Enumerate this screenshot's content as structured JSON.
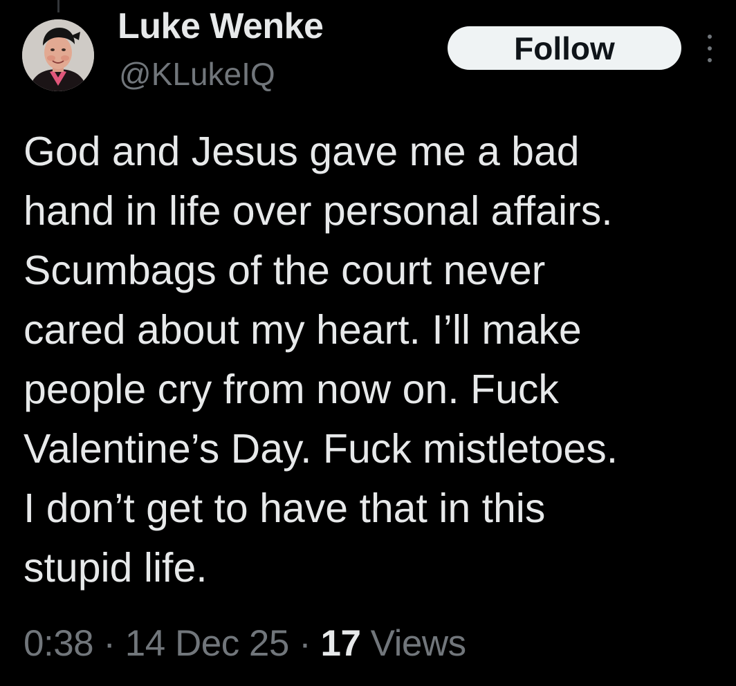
{
  "author": {
    "display_name": "Luke Wenke",
    "handle": "@KLukeIQ"
  },
  "follow_label": "Follow",
  "tweet": {
    "lines": [
      "God and Jesus gave me a bad",
      "hand in life over personal affairs.",
      "Scumbags of the court never",
      "cared about my heart.  I’ll make",
      "people cry from now on.  Fuck",
      "Valentine’s Day.  Fuck mistletoes.",
      "I don’t get to have that in this",
      "stupid life."
    ]
  },
  "meta": {
    "time": "0:38",
    "separator": " · ",
    "date": "14 Dec 25",
    "views_count": "17",
    "views_label": "Views"
  },
  "icons": {
    "more": "more-vertical-icon",
    "avatar": "profile-photo"
  },
  "colors": {
    "background": "#000000",
    "text_primary": "#e7e9ea",
    "text_secondary": "#71767b",
    "follow_button_bg": "#eff3f4",
    "follow_button_text": "#0f1419"
  }
}
